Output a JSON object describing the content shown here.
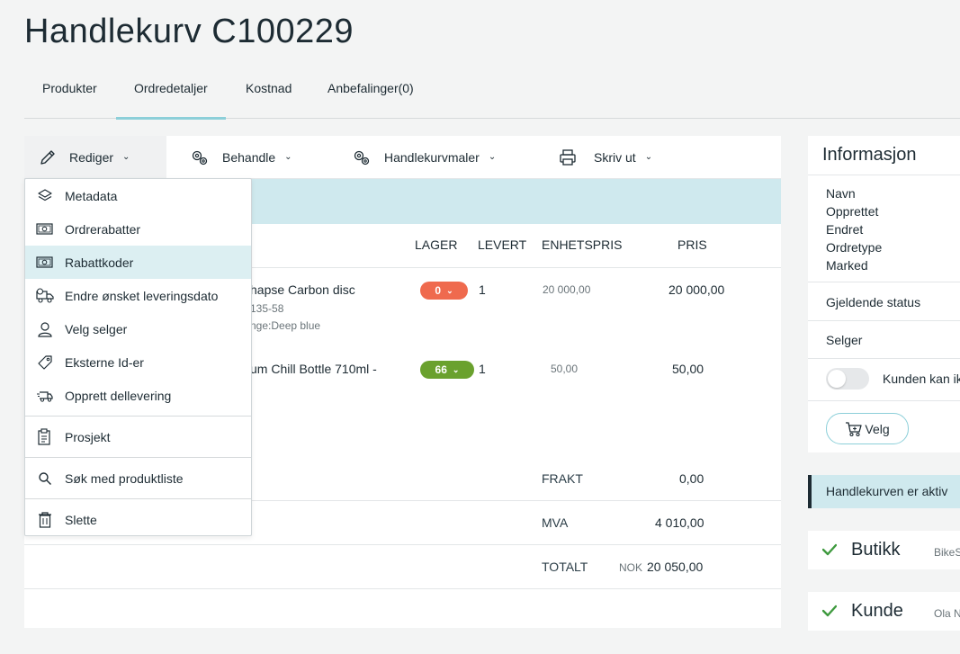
{
  "page": {
    "title": "Handlekurv C100229"
  },
  "tabs": [
    {
      "label": "Produkter"
    },
    {
      "label": "Ordredetaljer"
    },
    {
      "label": "Kostnad"
    },
    {
      "label": "Anbefalinger(0)"
    }
  ],
  "toolbar": {
    "edit": "Rediger",
    "process": "Behandle",
    "templates": "Handlekurvmaler",
    "print": "Skriv ut"
  },
  "table": {
    "headers": {
      "stock": "LAGER",
      "delivered": "LEVERT",
      "unit_price": "ENHETSPRIS",
      "price": "PRIS"
    },
    "rows": [
      {
        "name": "hapse Carbon disc",
        "sub1": "135-58",
        "sub2": "nge:Deep blue",
        "stock": "0",
        "delivered": "1",
        "unit_price": "20 000,00",
        "price": "20 000,00",
        "stock_color": "#ef6a4e"
      },
      {
        "name": "um Chill Bottle 710ml -",
        "stock": "66",
        "delivered": "1",
        "unit_price": "50,00",
        "price": "50,00",
        "stock_color": "#6aa12e"
      }
    ],
    "summary": {
      "shipping_label": "FRAKT",
      "shipping_value": "0,00",
      "vat_label": "MVA",
      "vat_value": "4 010,00",
      "total_label": "TOTALT",
      "currency": "NOK",
      "total_value": "20 050,00"
    }
  },
  "dropdown": {
    "items": [
      {
        "label": "Metadata",
        "icon": "layers-icon"
      },
      {
        "label": "Ordrerabatter",
        "icon": "money-icon"
      },
      {
        "label": "Rabattkoder",
        "icon": "money-icon",
        "selected": true
      },
      {
        "label": "Endre ønsket leveringsdato",
        "icon": "truck-clock-icon"
      },
      {
        "label": "Velg selger",
        "icon": "user-icon"
      },
      {
        "label": "Eksterne Id-er",
        "icon": "tag-icon"
      },
      {
        "label": "Opprett dellevering",
        "icon": "delivery-icon"
      },
      {
        "label": "Prosjekt",
        "icon": "clipboard-icon"
      },
      {
        "label": "Søk med produktliste",
        "icon": "search-icon"
      },
      {
        "label": "Slette",
        "icon": "trash-icon"
      }
    ]
  },
  "info": {
    "title": "Informasjon",
    "fields": [
      "Navn",
      "Opprettet",
      "Endret",
      "Ordretype",
      "Marked"
    ],
    "status_label": "Gjeldende status",
    "seller_label": "Selger",
    "toggle_label": "Kunden kan ik",
    "choose_button": "Velg",
    "active_text": "Handlekurven er aktiv"
  },
  "cards": [
    {
      "title": "Butikk",
      "value": "BikeS"
    },
    {
      "title": "Kunde",
      "value": "Ola N"
    }
  ],
  "colors": {
    "accent": "#8ccfd9",
    "teal_bg": "#cfe9ee",
    "danger": "#ef6a4e",
    "success": "#6aa12e",
    "check": "#3f9a3f"
  }
}
